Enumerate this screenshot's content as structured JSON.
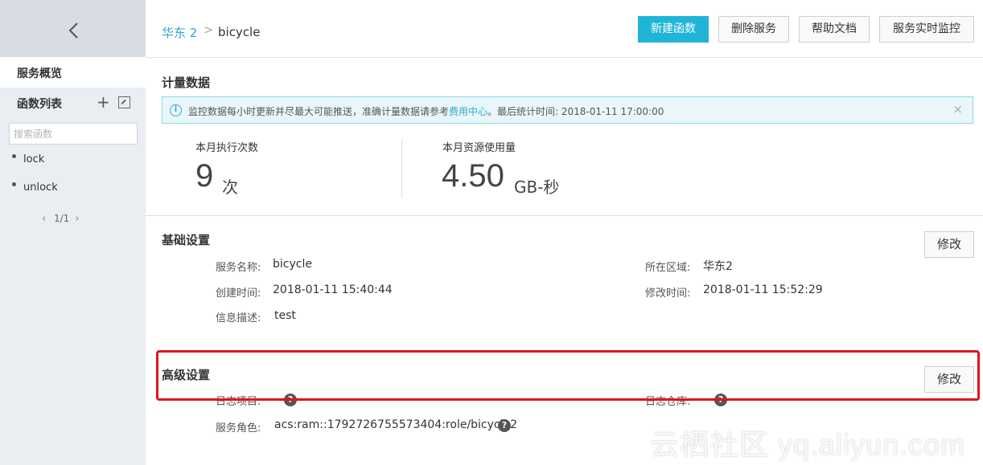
{
  "sidebar": {
    "overview_label": "服务概览",
    "function_list_label": "函数列表",
    "search_placeholder": "搜索函数",
    "functions": [
      "lock",
      "unlock"
    ],
    "pager": "1/1"
  },
  "header": {
    "breadcrumb_region": "华东 2",
    "breadcrumb_separator": ">",
    "breadcrumb_service": "bicycle",
    "buttons": {
      "new_function": "新建函数",
      "delete_service": "删除服务",
      "help_docs": "帮助文档",
      "realtime_monitor": "服务实时监控"
    }
  },
  "metering": {
    "title": "计量数据",
    "notice_prefix": "监控数据每小时更新并尽最大可能推送，准确计量数据请参考",
    "notice_link": "费用中心",
    "notice_suffix": "。最后统计时间: 2018-01-11 17:00:00",
    "close_glyph": "×",
    "executions_label": "本月执行次数",
    "executions_value": "9",
    "executions_unit": "次",
    "resource_label": "本月资源使用量",
    "resource_value": "4.50",
    "resource_unit": "GB-秒"
  },
  "basic": {
    "title": "基础设置",
    "edit_label": "修改",
    "service_name_label": "服务名称:",
    "service_name": "bicycle",
    "region_label": "所在区域:",
    "region": "华东2",
    "created_label": "创建时间:",
    "created": "2018-01-11 15:40:44",
    "modified_label": "修改时间:",
    "modified": "2018-01-11 15:52:29",
    "description_label": "信息描述:",
    "description": "test"
  },
  "advanced": {
    "title": "高级设置",
    "edit_label": "修改",
    "log_project_label": "日志项目:",
    "logstore_label": "日志仓库:",
    "role_label": "服务角色:",
    "role": "acs:ram::1792726755573404:role/bicycle2"
  },
  "watermark": "云栖社区 yq.aliyun.com",
  "colors": {
    "accent": "#1fb5d7",
    "link": "#2fa8c9",
    "highlight_border": "#e0141e"
  }
}
